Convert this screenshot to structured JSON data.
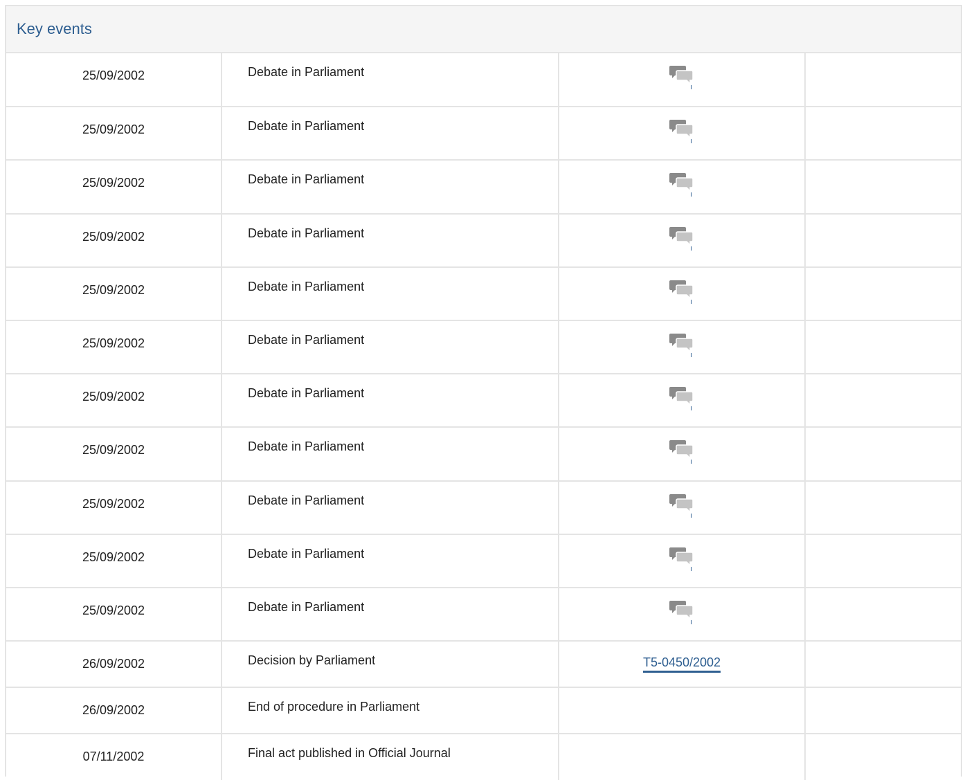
{
  "panel": {
    "title": "Key events"
  },
  "colors": {
    "accent": "#2f5f91",
    "border": "#e4e4e4",
    "header_bg": "#f5f5f5"
  },
  "events": [
    {
      "date": "25/09/2002",
      "event": "Debate in Parliament",
      "ref_type": "icon",
      "icon": "debate-icon"
    },
    {
      "date": "25/09/2002",
      "event": "Debate in Parliament",
      "ref_type": "icon",
      "icon": "debate-icon"
    },
    {
      "date": "25/09/2002",
      "event": "Debate in Parliament",
      "ref_type": "icon",
      "icon": "debate-icon"
    },
    {
      "date": "25/09/2002",
      "event": "Debate in Parliament",
      "ref_type": "icon",
      "icon": "debate-icon"
    },
    {
      "date": "25/09/2002",
      "event": "Debate in Parliament",
      "ref_type": "icon",
      "icon": "debate-icon"
    },
    {
      "date": "25/09/2002",
      "event": "Debate in Parliament",
      "ref_type": "icon",
      "icon": "debate-icon"
    },
    {
      "date": "25/09/2002",
      "event": "Debate in Parliament",
      "ref_type": "icon",
      "icon": "debate-icon"
    },
    {
      "date": "25/09/2002",
      "event": "Debate in Parliament",
      "ref_type": "icon",
      "icon": "debate-icon"
    },
    {
      "date": "25/09/2002",
      "event": "Debate in Parliament",
      "ref_type": "icon",
      "icon": "debate-icon"
    },
    {
      "date": "25/09/2002",
      "event": "Debate in Parliament",
      "ref_type": "icon",
      "icon": "debate-icon"
    },
    {
      "date": "25/09/2002",
      "event": "Debate in Parliament",
      "ref_type": "icon",
      "icon": "debate-icon"
    },
    {
      "date": "26/09/2002",
      "event": "Decision by Parliament",
      "ref_type": "link",
      "ref": "T5-0450/2002"
    },
    {
      "date": "26/09/2002",
      "event": "End of procedure in Parliament",
      "ref_type": "none"
    },
    {
      "date": "07/11/2002",
      "event": "Final act published in Official Journal",
      "ref_type": "none"
    }
  ]
}
